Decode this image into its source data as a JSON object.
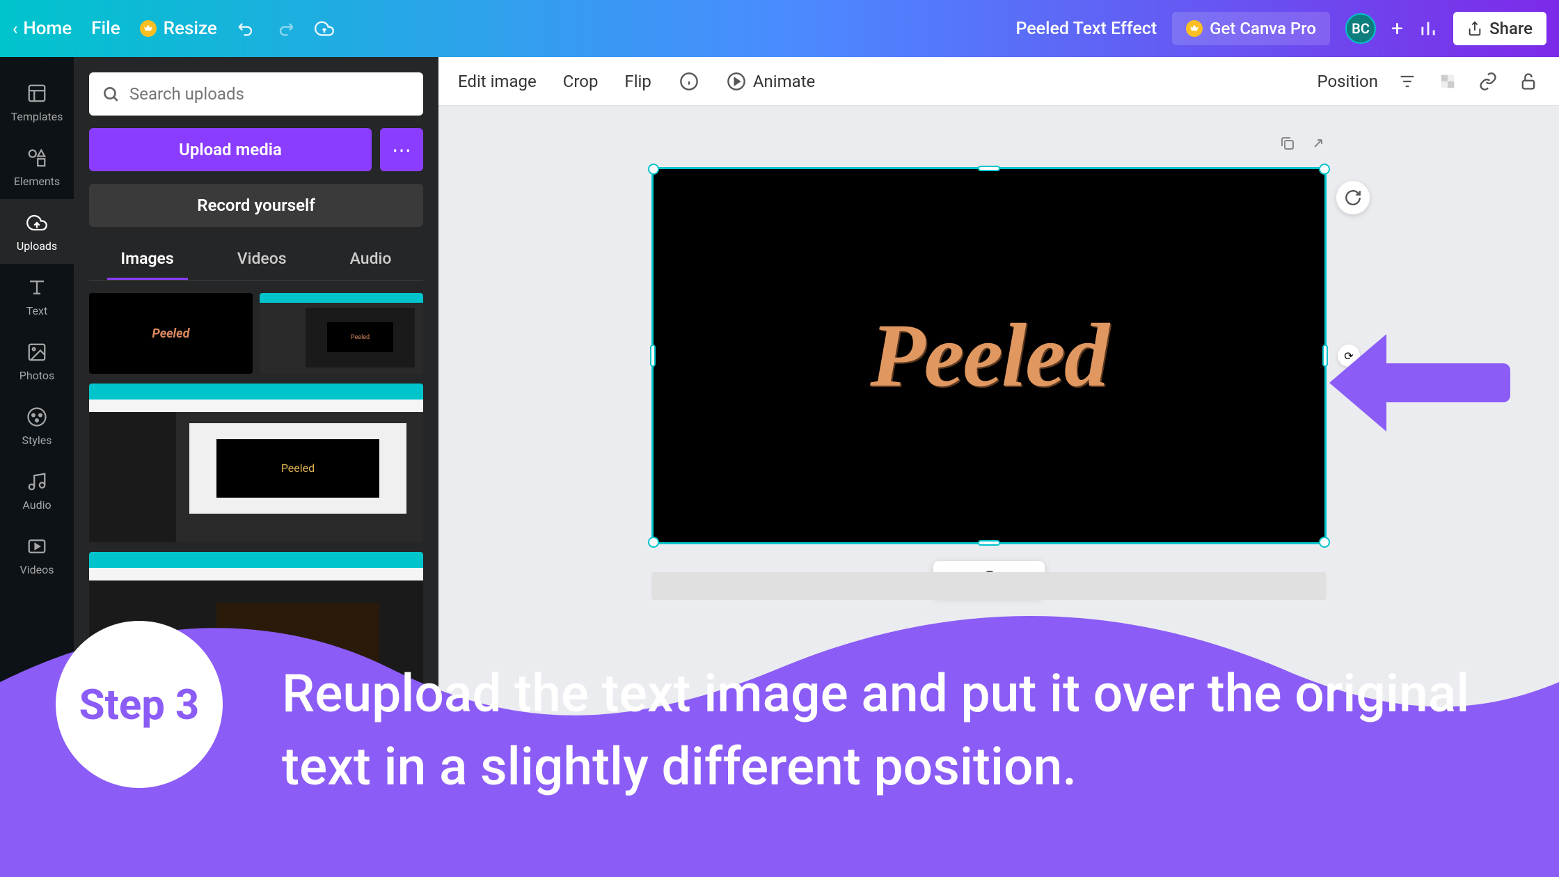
{
  "header": {
    "home": "Home",
    "file": "File",
    "resize": "Resize",
    "doc_title": "Peeled Text Effect",
    "get_pro": "Get Canva Pro",
    "avatar_initials": "BC",
    "share": "Share"
  },
  "rail": {
    "templates": "Templates",
    "elements": "Elements",
    "uploads": "Uploads",
    "text": "Text",
    "photos": "Photos",
    "styles": "Styles",
    "audio": "Audio",
    "videos": "Videos"
  },
  "panel": {
    "search_placeholder": "Search uploads",
    "upload": "Upload media",
    "record": "Record yourself",
    "tabs": {
      "images": "Images",
      "videos": "Videos",
      "audio": "Audio"
    },
    "thumb_peeled": "Peeled"
  },
  "context": {
    "edit_image": "Edit image",
    "crop": "Crop",
    "flip": "Flip",
    "animate": "Animate",
    "position": "Position"
  },
  "canvas": {
    "main_text": "Peeled"
  },
  "overlay": {
    "step_label": "Step 3",
    "text": "Reupload the text image and put it over the original text in a slightly different position."
  }
}
